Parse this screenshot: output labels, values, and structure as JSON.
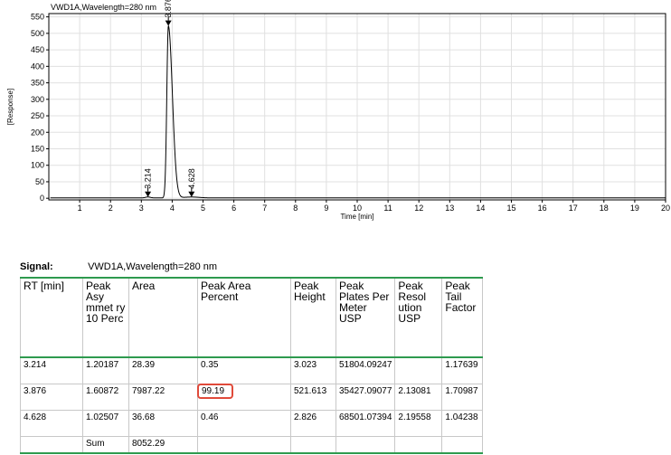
{
  "chart_data": {
    "type": "line",
    "title": "VWD1A,Wavelength=280 nm",
    "xlabel": "Time [min]",
    "ylabel": "[Response]",
    "xlim": [
      0,
      20
    ],
    "ylim": [
      -5,
      560
    ],
    "xticks": [
      1,
      2,
      3,
      4,
      5,
      6,
      7,
      8,
      9,
      10,
      11,
      12,
      13,
      14,
      15,
      16,
      17,
      18,
      19,
      20
    ],
    "yticks": [
      0,
      50,
      100,
      150,
      200,
      250,
      300,
      350,
      400,
      450,
      500,
      550
    ],
    "grid": true,
    "baseline": 1,
    "peaks": [
      {
        "rt": 3.214,
        "label": "3.214",
        "height": 3.0,
        "sigma": 0.08
      },
      {
        "rt": 3.876,
        "label": "3.876",
        "height": 521.6,
        "sigma": 0.05,
        "tail": 0.13
      },
      {
        "rt": 4.628,
        "label": "4.628",
        "height": 2.8,
        "sigma": 0.25
      }
    ]
  },
  "signal": {
    "label": "Signal:",
    "value": "VWD1A,Wavelength=280 nm"
  },
  "table": {
    "headers": [
      "RT [min]",
      "Peak Asy mmet ry 10 Perc",
      "Area",
      "Peak Area Percent",
      "Peak Height",
      "Peak Plates Per Meter USP",
      "Peak Resol ution USP",
      "Peak Tail Factor"
    ],
    "rows": [
      [
        "3.214",
        "1.20187",
        "28.39",
        "0.35",
        "3.023",
        "51804.09247",
        "",
        "1.17639"
      ],
      [
        "3.876",
        "1.60872",
        "7987.22",
        "99.19",
        "521.613",
        "35427.09077",
        "2.13081",
        "1.70987"
      ],
      [
        "4.628",
        "1.02507",
        "36.68",
        "0.46",
        "2.826",
        "68501.07394",
        "2.19558",
        "1.04238"
      ]
    ],
    "sum_label": "Sum",
    "sum_value": "8052.29",
    "highlight_color": "#e04a3a"
  }
}
